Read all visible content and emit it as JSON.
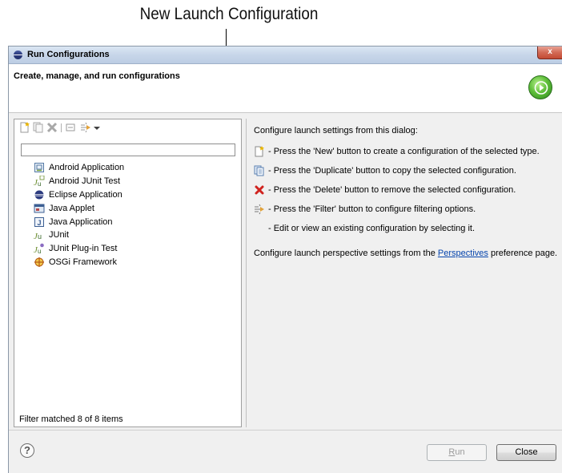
{
  "callout": {
    "label": "New Launch Configuration"
  },
  "window": {
    "title": "Run Configurations",
    "header_text": "Create, manage, and run configurations"
  },
  "filter": {
    "value": "",
    "placeholder": ""
  },
  "tree": {
    "items": [
      {
        "label": "Android Application",
        "icon": "android-app-icon"
      },
      {
        "label": "Android JUnit Test",
        "icon": "junit-android-icon"
      },
      {
        "label": "Eclipse Application",
        "icon": "eclipse-icon"
      },
      {
        "label": "Java Applet",
        "icon": "java-applet-icon"
      },
      {
        "label": "Java Application",
        "icon": "java-app-icon"
      },
      {
        "label": "JUnit",
        "icon": "junit-icon"
      },
      {
        "label": "JUnit Plug-in Test",
        "icon": "junit-plugin-icon"
      },
      {
        "label": "OSGi Framework",
        "icon": "osgi-icon"
      }
    ]
  },
  "status": "Filter matched 8 of 8 items",
  "info": {
    "intro": "Configure launch settings from this dialog:",
    "rows": [
      "- Press the 'New' button to create a configuration of the selected type.",
      "- Press the 'Duplicate' button to copy the selected configuration.",
      "- Press the 'Delete' button to remove the selected configuration.",
      "- Press the 'Filter' button to configure filtering options.",
      "- Edit or view an existing configuration by selecting it."
    ],
    "perspectives_prefix": "Configure launch perspective settings from the ",
    "perspectives_link": "Perspectives",
    "perspectives_suffix": " preference page."
  },
  "buttons": {
    "run_prefix": "",
    "run_mnemonic": "R",
    "run_rest": "un",
    "close": "Close"
  },
  "close_glyph": "x",
  "help_glyph": "?"
}
